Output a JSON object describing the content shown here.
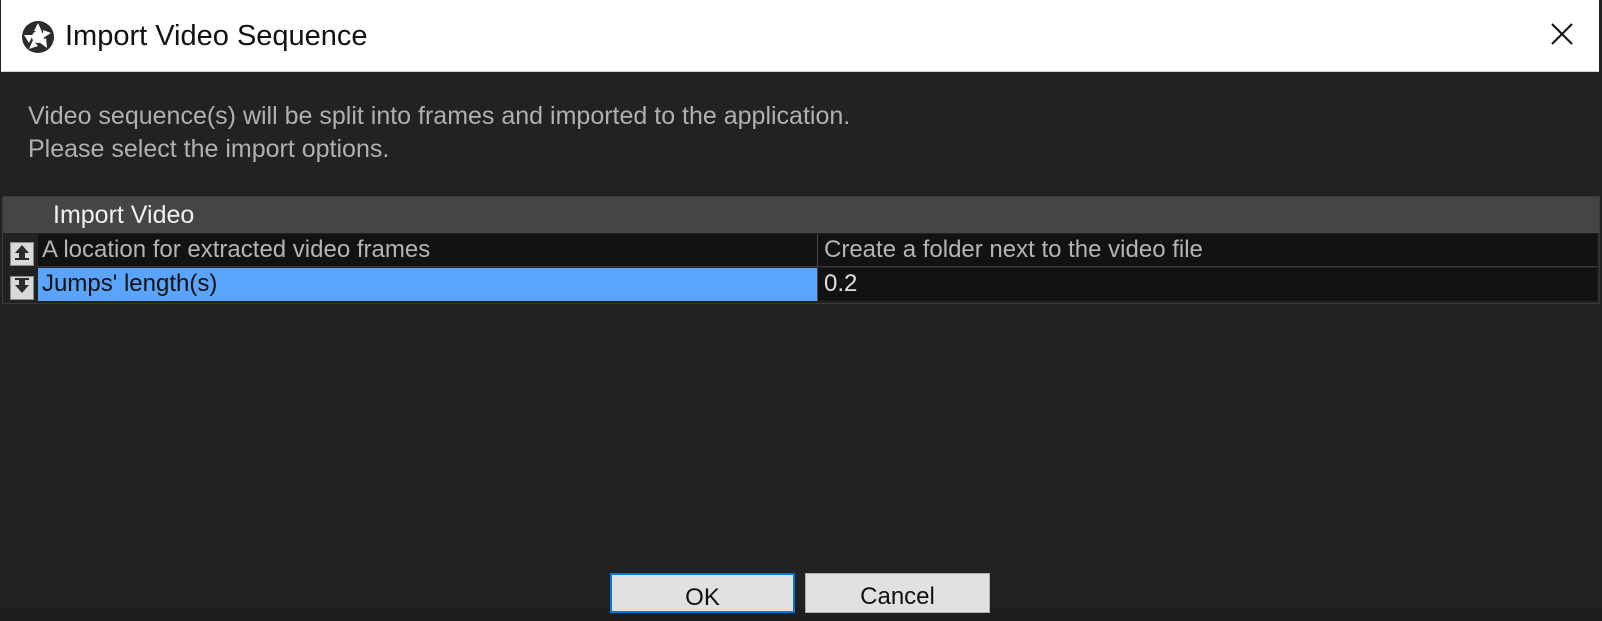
{
  "window": {
    "title": "Import Video Sequence",
    "app_icon": "aperture-icon",
    "close_icon": "close-icon"
  },
  "description": {
    "line1": "Video sequence(s) will be split into frames and imported to the application.",
    "line2": "Please select the import options."
  },
  "grid": {
    "group_title": "Import Video",
    "rows": [
      {
        "name": "A location for extracted video frames",
        "value": "Create a folder next to the video file",
        "nav_icon": "arrow-up-icon"
      },
      {
        "name": "Jumps' length(s)",
        "value": "0.2",
        "nav_icon": "arrow-down-icon",
        "selected": true
      }
    ]
  },
  "buttons": {
    "ok_label": "OK",
    "cancel_label": "Cancel"
  },
  "colors": {
    "selection": "#5aa4ff",
    "background": "#222222",
    "focus_border": "#0078d7"
  }
}
